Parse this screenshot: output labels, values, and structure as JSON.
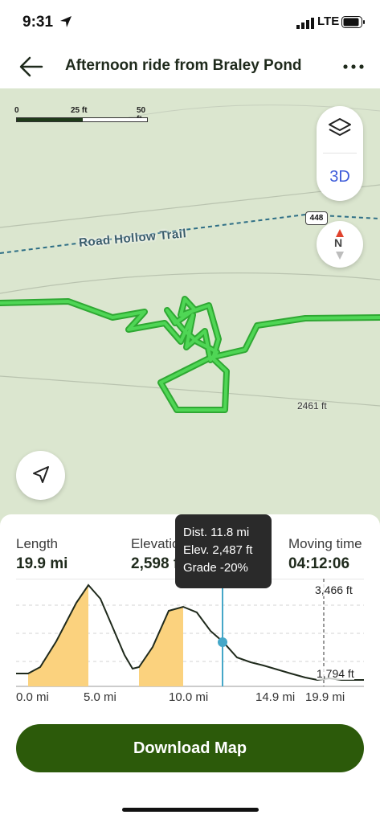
{
  "status_bar": {
    "time": "9:31",
    "network": "LTE",
    "icons": [
      "location-arrow-icon",
      "signal-icon",
      "battery-icon"
    ]
  },
  "header": {
    "title": "Afternoon ride from Braley Pond",
    "back_icon": "arrow-left-icon",
    "more_icon": "more-horizontal-icon"
  },
  "map": {
    "scale": {
      "labels": [
        "0",
        "25 ft",
        "50 ft"
      ]
    },
    "controls": {
      "layers_icon": "layers-icon",
      "mode_3d_label": "3D",
      "compass_label": "N"
    },
    "trail_label": "Road Hollow Trail",
    "road_badge": "448",
    "contour_label": "2461 ft",
    "locate_icon": "navigation-arrow-icon",
    "colors": {
      "background": "#dbe6cf",
      "route": "#35c43a",
      "trail": "#2f6f86"
    }
  },
  "stats": [
    {
      "label": "Length",
      "value": "19.9 mi"
    },
    {
      "label": "Elevation gain",
      "value": "2,598 ft"
    },
    {
      "label": "Moving time",
      "value": "04:12:06"
    }
  ],
  "tooltip": {
    "distance": "Dist. 11.8 mi",
    "elevation": "Elev. 2,487 ft",
    "grade": "Grade -20%"
  },
  "chart": {
    "y_max_label": "3,466 ft",
    "y_min_label": "1,794 ft",
    "x_labels": [
      "0.0 mi",
      "5.0 mi",
      "10.0 mi",
      "14.9 mi",
      "19.9 mi"
    ],
    "colors": {
      "line": "#1f2a1c",
      "climb_fill": "#fbd27e",
      "cursor": "#45a7c8"
    }
  },
  "actions": {
    "download_label": "Download Map"
  }
}
